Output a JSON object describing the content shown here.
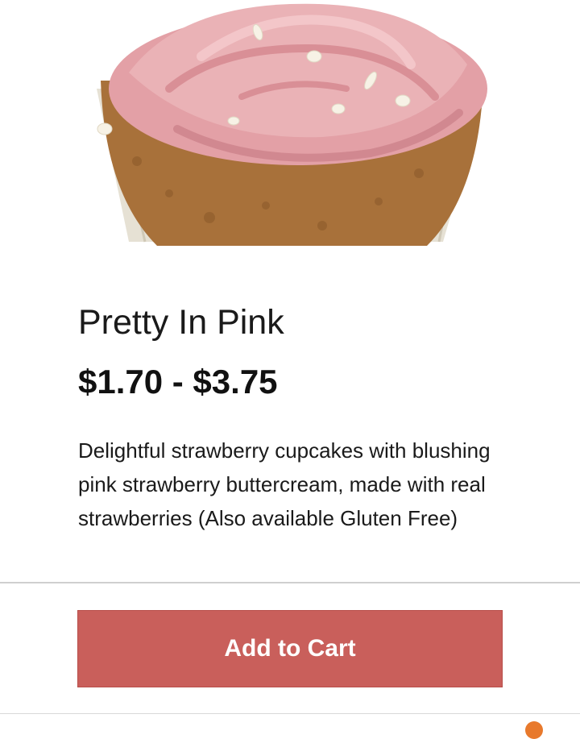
{
  "product": {
    "image_alt": "cupcake-photo",
    "title": "Pretty In Pink",
    "price_range": "$1.70 - $3.75",
    "description": "Delightful strawberry cupcakes with blushing pink strawberry buttercream, made with real strawberries (Also available Gluten Free)"
  },
  "actions": {
    "add_to_cart_label": "Add to Cart"
  },
  "colors": {
    "button_bg": "#c95f5b",
    "frosting": "#e9a9ae",
    "cake": "#a8713a",
    "liner": "#e6e1d4"
  }
}
